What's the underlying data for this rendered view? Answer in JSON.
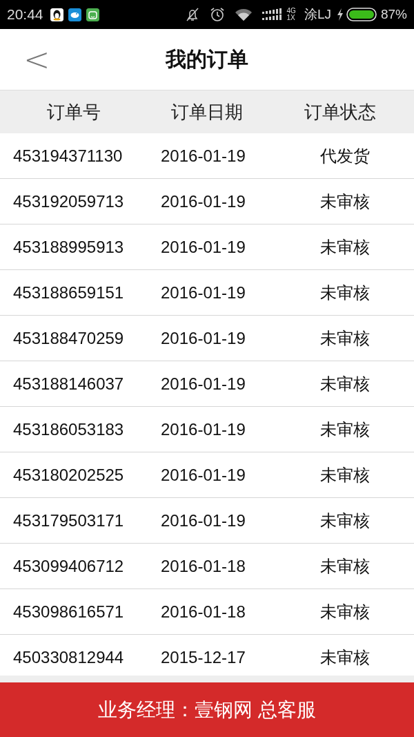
{
  "status_bar": {
    "time": "20:44",
    "network_top": "4G",
    "network_bottom": "1X",
    "carrier": "涂LJ",
    "battery": "87%"
  },
  "header": {
    "back": "<",
    "title": "我的订单"
  },
  "table": {
    "columns": [
      "订单号",
      "订单日期",
      "订单状态"
    ],
    "rows": [
      {
        "order_no": "453194371130",
        "date": "2016-01-19",
        "status": "代发货"
      },
      {
        "order_no": "453192059713",
        "date": "2016-01-19",
        "status": "未审核"
      },
      {
        "order_no": "453188995913",
        "date": "2016-01-19",
        "status": "未审核"
      },
      {
        "order_no": "453188659151",
        "date": "2016-01-19",
        "status": "未审核"
      },
      {
        "order_no": "453188470259",
        "date": "2016-01-19",
        "status": "未审核"
      },
      {
        "order_no": "453188146037",
        "date": "2016-01-19",
        "status": "未审核"
      },
      {
        "order_no": "453186053183",
        "date": "2016-01-19",
        "status": "未审核"
      },
      {
        "order_no": "453180202525",
        "date": "2016-01-19",
        "status": "未审核"
      },
      {
        "order_no": "453179503171",
        "date": "2016-01-19",
        "status": "未审核"
      },
      {
        "order_no": "453099406712",
        "date": "2016-01-18",
        "status": "未审核"
      },
      {
        "order_no": "453098616571",
        "date": "2016-01-18",
        "status": "未审核"
      },
      {
        "order_no": "450330812944",
        "date": "2015-12-17",
        "status": "未审核"
      }
    ]
  },
  "footer": {
    "label": "业务经理：壹钢网 总客服"
  }
}
